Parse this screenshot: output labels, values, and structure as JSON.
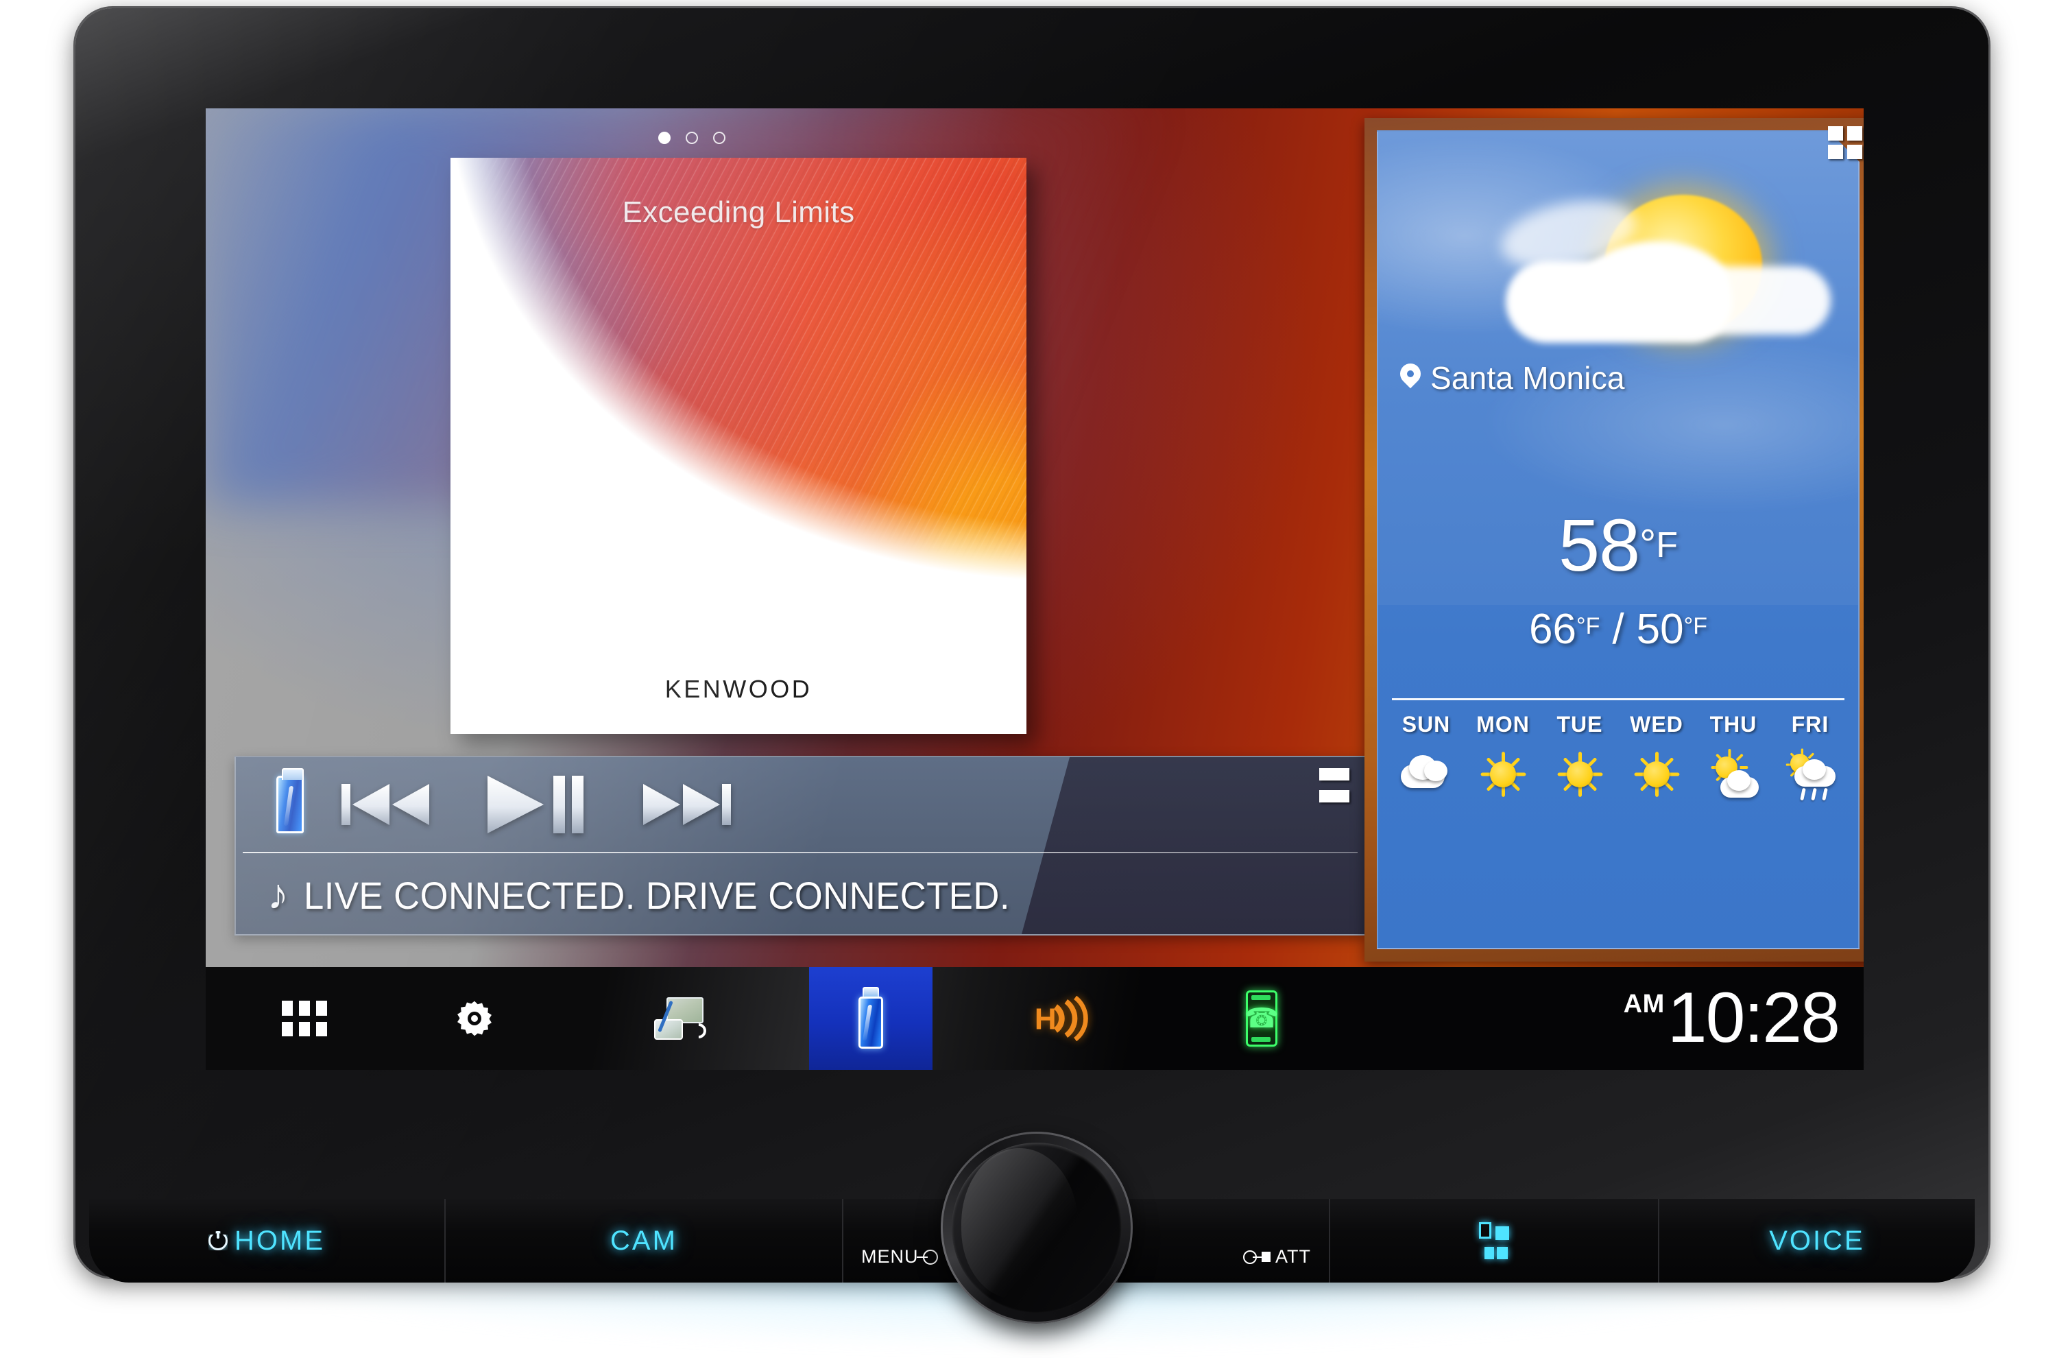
{
  "device": {
    "brand": "KENWOOD"
  },
  "screen": {
    "page_indicator": {
      "total": 3,
      "active_index": 0
    }
  },
  "media": {
    "source_icon": "usb-icon",
    "album_title": "Exceeding Limits",
    "album_brand": "KENWOOD",
    "track_text": "LIVE CONNECTED. DRIVE CONNECTED.",
    "note_icon": "music-note-icon",
    "controls": [
      {
        "name": "previous-track-button",
        "icon": "skip-back-icon"
      },
      {
        "name": "play-pause-button",
        "icon": "play-pause-icon"
      },
      {
        "name": "next-track-button",
        "icon": "skip-forward-icon"
      }
    ],
    "list_button_icon": "list-lines-icon"
  },
  "weather": {
    "city": "Santa Monica",
    "location_icon": "map-pin-icon",
    "current_temp": "58",
    "degree": "°",
    "unit": "F",
    "high": "66",
    "low": "50",
    "separator": "/",
    "widget_button_icon": "grid-2x2-icon",
    "forecast": [
      {
        "day": "SUN",
        "condition": "cloudy"
      },
      {
        "day": "MON",
        "condition": "sunny"
      },
      {
        "day": "TUE",
        "condition": "sunny"
      },
      {
        "day": "WED",
        "condition": "sunny"
      },
      {
        "day": "THU",
        "condition": "partly-cloudy"
      },
      {
        "day": "FRI",
        "condition": "rain"
      }
    ]
  },
  "navbar": {
    "items": [
      {
        "name": "apps-button",
        "icon": "apps-grid-icon",
        "active": false
      },
      {
        "name": "settings-button",
        "icon": "gear-icon",
        "active": false
      },
      {
        "name": "navigation-button",
        "icon": "smartphone-mirror-icon",
        "active": false
      },
      {
        "name": "usb-source-button",
        "icon": "usb-icon",
        "active": true
      },
      {
        "name": "hd-radio-button",
        "icon": "hd-radio-icon",
        "active": false
      },
      {
        "name": "phone-button",
        "icon": "phone-handset-icon",
        "active": false
      }
    ],
    "clock": {
      "ampm": "AM",
      "time": "10:28"
    }
  },
  "hardware_buttons": [
    {
      "name": "home-button",
      "label": "HOME",
      "icon": "power-icon"
    },
    {
      "name": "cam-button",
      "label": "CAM",
      "icon": null
    },
    {
      "name": "menu-button",
      "label": "MENU",
      "icon": "menu-enter-icon"
    },
    {
      "name": "att-button",
      "label": "ATT",
      "icon": "attenuate-icon"
    },
    {
      "name": "screens-button",
      "label": "",
      "icon": "screen-layout-icon"
    },
    {
      "name": "voice-button",
      "label": "VOICE",
      "icon": null
    }
  ],
  "knob": {
    "name": "volume-knob"
  }
}
